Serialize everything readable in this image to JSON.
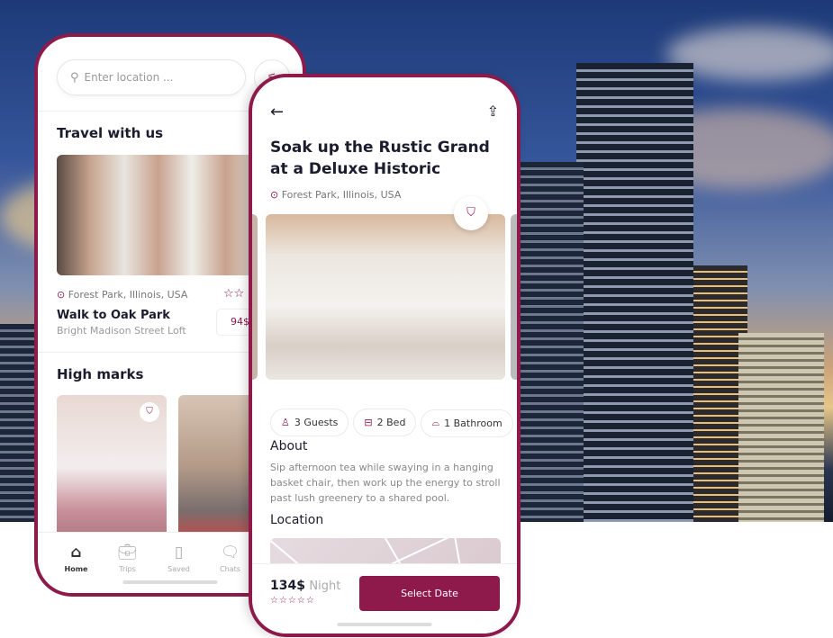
{
  "home": {
    "search_placeholder": "Enter location ...",
    "section1_title": "Travel with us",
    "listing": {
      "location": "Forest Park, Illinois, USA",
      "title": "Walk to Oak Park",
      "subtitle": "Bright Madison Street Loft",
      "price": "94$",
      "stars": "☆☆"
    },
    "section2_title": "High marks",
    "nav": [
      {
        "label": "Home",
        "icon": "home-icon"
      },
      {
        "label": "Trips",
        "icon": "briefcase-icon"
      },
      {
        "label": "Saved",
        "icon": "bookmark-icon"
      },
      {
        "label": "Chats",
        "icon": "chat-icon"
      }
    ]
  },
  "detail": {
    "title": "Soak up the Rustic Grand at a Deluxe Historic",
    "location": "Forest Park, Illinois, USA",
    "chips": [
      "3 Guests",
      "2 Bed",
      "1 Bathroom"
    ],
    "about_heading": "About",
    "about_text": "Sip afternoon tea while swaying in a hanging basket chair, then work up the energy to stroll past lush greenery to a shared pool.",
    "location_heading": "Location",
    "price": "134$",
    "price_unit": "Night",
    "stars": "☆☆☆☆☆",
    "cta": "Select Date"
  },
  "colors": {
    "accent": "#8e1a4c"
  }
}
